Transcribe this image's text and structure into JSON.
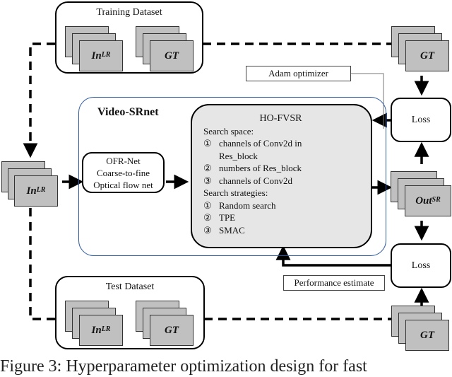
{
  "training_dataset": {
    "title": "Training Dataset",
    "input_label": "In",
    "input_sup": "LR",
    "gt_label": "GT"
  },
  "test_dataset": {
    "title": "Test Dataset",
    "input_label": "In",
    "input_sup": "LR",
    "gt_label": "GT"
  },
  "input_stack": {
    "label": "In",
    "sup": "LR"
  },
  "video_srnet": {
    "title": "Video-SRnet"
  },
  "ofr_net": {
    "lines": [
      "OFR-Net",
      "Coarse-to-fine",
      "Optical flow net"
    ]
  },
  "ho_fvsr": {
    "title": "HO-FVSR",
    "search_space_label": "Search space:",
    "search_space": [
      {
        "num": "①",
        "text": "channels of Conv2d in"
      },
      {
        "num": "",
        "text": "Res_block"
      },
      {
        "num": "②",
        "text": "numbers of Res_block"
      },
      {
        "num": "③",
        "text": "channels of Conv2d"
      }
    ],
    "strategies_label": "Search strategies:",
    "strategies": [
      {
        "num": "①",
        "text": "Random search"
      },
      {
        "num": "②",
        "text": "TPE"
      },
      {
        "num": "③",
        "text": "SMAC"
      }
    ]
  },
  "adam_optimizer": {
    "label": "Adam optimizer"
  },
  "performance_estimate": {
    "label": "Performance estimate"
  },
  "gt_top": {
    "label": "GT"
  },
  "gt_bottom": {
    "label": "GT"
  },
  "out_sr": {
    "label": "Out",
    "sup": "SR"
  },
  "loss_top": {
    "label": "Loss"
  },
  "loss_bottom": {
    "label": "Loss"
  },
  "caption": {
    "text": "Figure 3:  Hyperparameter optimization design for fast"
  },
  "colors": {
    "srnet_border": "#2c5aa0",
    "frame_fill": "#c0c0c0",
    "ho_fill": "#e6e6e6"
  }
}
